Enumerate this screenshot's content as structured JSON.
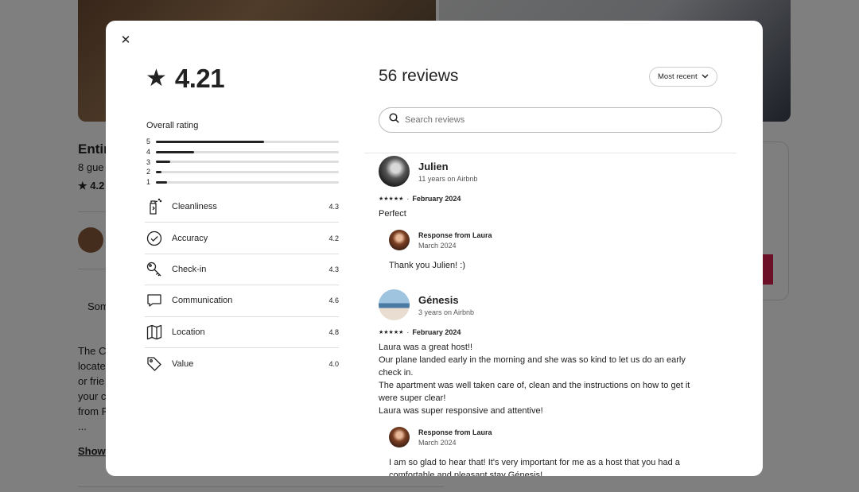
{
  "background": {
    "title": "Entir",
    "subtitle": "8 gue",
    "rating": "4.2",
    "chip": "Som",
    "paragraph": [
      "The C",
      "locate",
      "or frie",
      "your c",
      "from F",
      "..."
    ],
    "show_more": "Show"
  },
  "modal": {
    "close_icon": "close-icon",
    "overall": {
      "value": "4.21",
      "label": "Overall rating",
      "distribution": [
        {
          "stars": "5",
          "fraction": 0.59
        },
        {
          "stars": "4",
          "fraction": 0.21
        },
        {
          "stars": "3",
          "fraction": 0.08
        },
        {
          "stars": "2",
          "fraction": 0.03
        },
        {
          "stars": "1",
          "fraction": 0.06
        }
      ]
    },
    "categories": [
      {
        "name": "Cleanliness",
        "value": "4.3",
        "icon": "spray-bottle-icon"
      },
      {
        "name": "Accuracy",
        "value": "4.2",
        "icon": "check-circle-icon"
      },
      {
        "name": "Check-in",
        "value": "4.3",
        "icon": "key-icon"
      },
      {
        "name": "Communication",
        "value": "4.6",
        "icon": "speech-bubble-icon"
      },
      {
        "name": "Location",
        "value": "4.8",
        "icon": "map-icon"
      },
      {
        "name": "Value",
        "value": "4.0",
        "icon": "tag-icon"
      }
    ],
    "reviews_header": {
      "title": "56 reviews",
      "sort_label": "Most recent",
      "search_placeholder": "Search reviews"
    },
    "reviews": [
      {
        "name": "Julien",
        "tenure": "11 years on Airbnb",
        "stars": "★★★★★",
        "date": "February 2024",
        "body": [
          "Perfect"
        ],
        "response": {
          "from": "Response from Laura",
          "date": "March 2024",
          "body": [
            "Thank you Julien! :)"
          ]
        }
      },
      {
        "name": "Génesis",
        "tenure": "3 years on Airbnb",
        "stars": "★★★★★",
        "date": "February 2024",
        "body": [
          "Laura was a great host!!",
          "Our plane landed early in the morning and she was so kind to let us do an early",
          "check in.",
          "The apartment was well taken care of, clean and the instructions on how to get it",
          "were super clear!",
          "Laura was super responsive and attentive!"
        ],
        "response": {
          "from": "Response from Laura",
          "date": "March 2024",
          "body": [
            "I am so glad to hear that! It's very important for me as a host that you had a",
            "comfortable and pleasant stay Génesis!"
          ]
        }
      }
    ]
  },
  "colors": {
    "accent": "#d6204e",
    "text": "#222222",
    "muted": "#717171",
    "divider": "#dddddd"
  }
}
